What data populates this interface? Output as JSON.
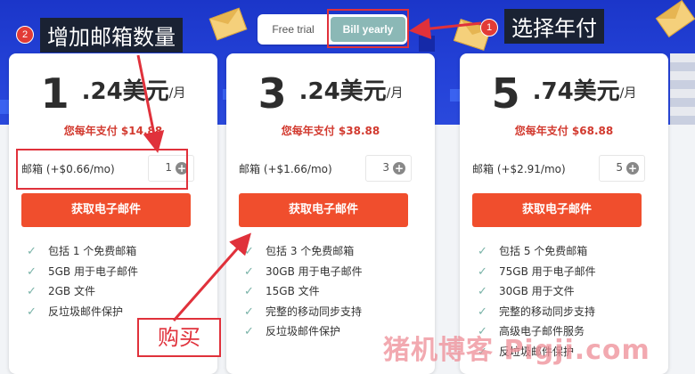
{
  "toggle": {
    "free_label": "Free trial",
    "yearly_label": "Bill yearly"
  },
  "annotations": {
    "step1_number": "1",
    "step1_label": "选择年付",
    "step2_number": "2",
    "step2_label": "增加邮箱数量",
    "buy_label": "购买"
  },
  "watermark": "猪机博客 Pigji.com",
  "colors": {
    "banner": "#2442d8",
    "button": "#f04e2d",
    "price_note": "#d23a2f",
    "annotation_red": "#e0313b",
    "toggle_active": "#8bb8b6"
  },
  "plans": [
    {
      "price_int": "1",
      "price_dec": ".24美元",
      "per": "/月",
      "yearly_pay": "您每年支付 $14.88",
      "mailbox_label": "邮箱 (+$0.66/mo)",
      "qty": "1",
      "button": "获取电子邮件",
      "features": [
        "包括 1 个免费邮箱",
        "5GB 用于电子邮件",
        "2GB 文件",
        "反垃圾邮件保护"
      ]
    },
    {
      "price_int": "3",
      "price_dec": ".24美元",
      "per": "/月",
      "yearly_pay": "您每年支付 $38.88",
      "mailbox_label": "邮箱 (+$1.66/mo)",
      "qty": "3",
      "button": "获取电子邮件",
      "features": [
        "包括 3 个免费邮箱",
        "30GB 用于电子邮件",
        "15GB 文件",
        "完整的移动同步支持",
        "反垃圾邮件保护"
      ]
    },
    {
      "price_int": "5",
      "price_dec": ".74美元",
      "per": "/月",
      "yearly_pay": "您每年支付 $68.88",
      "mailbox_label": "邮箱 (+$2.91/mo)",
      "qty": "5",
      "button": "获取电子邮件",
      "features": [
        "包括 5 个免费邮箱",
        "75GB 用于电子邮件",
        "30GB 用于文件",
        "完整的移动同步支持",
        "高级电子邮件服务",
        "反垃圾邮件保护"
      ]
    }
  ]
}
